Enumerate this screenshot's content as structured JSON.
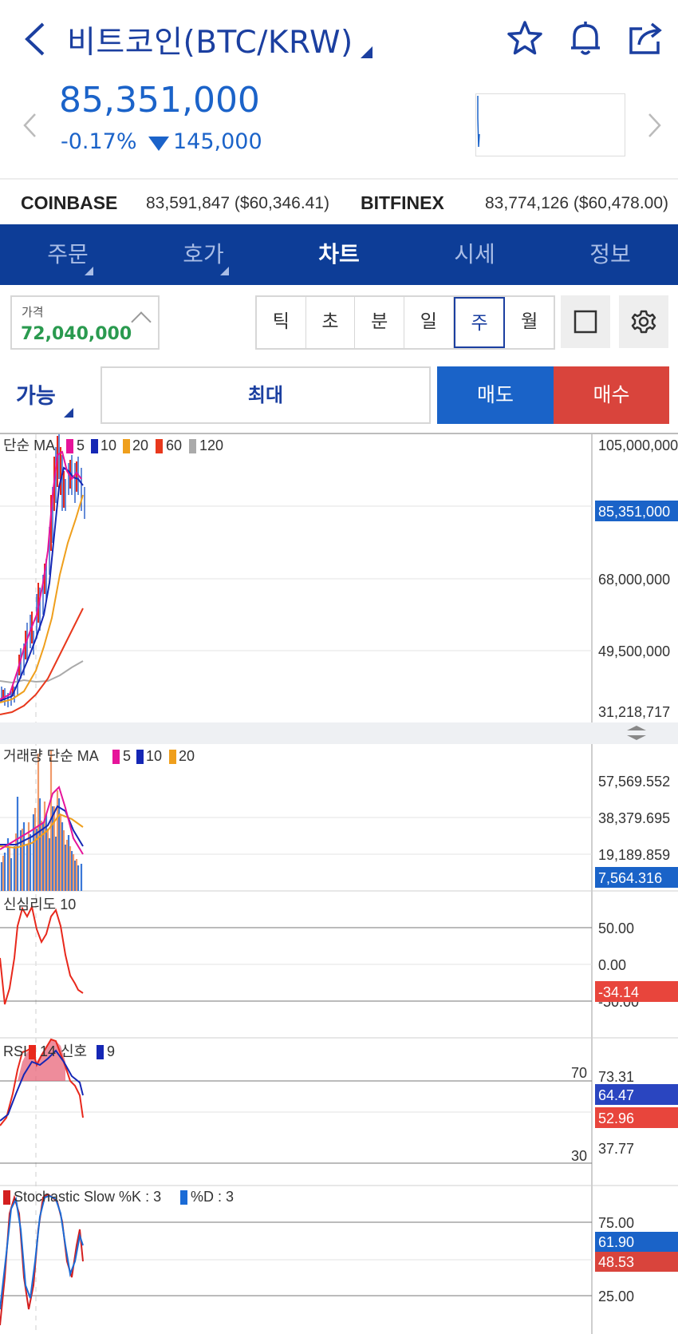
{
  "header": {
    "title": "비트코인(BTC/KRW)",
    "price": "85,351,000",
    "change_pct": "-0.17%",
    "change_amt": "145,000"
  },
  "exchanges": [
    {
      "name": "COINBASE",
      "value": "83,591,847 ($60,346.41)"
    },
    {
      "name": "BITFINEX",
      "value": "83,774,126 ($60,478.00)"
    }
  ],
  "tabs": [
    "주문",
    "호가",
    "차트",
    "시세",
    "정보"
  ],
  "active_tab": "차트",
  "toolbar": {
    "price_label": "가격",
    "price_value": "72,040,000",
    "periods": [
      "틱",
      "초",
      "분",
      "일",
      "주",
      "월"
    ],
    "active_period": "주"
  },
  "order": {
    "avail_label": "가능",
    "max_label": "최대",
    "sell_label": "매도",
    "buy_label": "매수"
  },
  "colors": {
    "accent_blue": "#0d3d97",
    "price_blue": "#1b63c9",
    "sell_blue": "#1a63c8",
    "buy_red": "#d9443c",
    "up_green": "#2a9a4f"
  },
  "chart_data": [
    {
      "type": "line",
      "legend_prefix": "단순 MA",
      "series": [
        {
          "name": "5",
          "color": "#e6149a"
        },
        {
          "name": "10",
          "color": "#1527b5"
        },
        {
          "name": "20",
          "color": "#ef9f1c"
        },
        {
          "name": "60",
          "color": "#e8381c"
        },
        {
          "name": "120",
          "color": "#aaaaaa"
        }
      ],
      "y_ticks": [
        "105,000,000",
        "68,000,000",
        "49,500,000",
        "31,218,717"
      ],
      "current_value": "85,351,000"
    },
    {
      "type": "bar",
      "legend_prefix": "거래량 단순 MA",
      "series": [
        {
          "name": "5",
          "color": "#e6149a"
        },
        {
          "name": "10",
          "color": "#1527b5"
        },
        {
          "name": "20",
          "color": "#ef9f1c"
        }
      ],
      "y_ticks": [
        "57,569.552",
        "38,379.695",
        "19,189.859"
      ],
      "current_value": "7,564.316"
    },
    {
      "type": "line",
      "legend": "신심리도 10",
      "y_ticks": [
        "50.00",
        "0.00",
        "-50.00"
      ],
      "current_value": "-34.14"
    },
    {
      "type": "line",
      "legend_prefix": "RSI",
      "series": [
        {
          "name": "14",
          "color": "#e8281c"
        },
        {
          "name": "신호",
          "color": "#1527b5"
        },
        {
          "name": "9",
          "color": "#1527b5"
        }
      ],
      "level_labels": [
        "70",
        "30"
      ],
      "y_ticks": [
        "73.31",
        "37.77"
      ],
      "badges": [
        "64.47",
        "52.96"
      ]
    },
    {
      "type": "line",
      "series": [
        {
          "name": "Stochastic Slow %K : 3",
          "color": "#d41f1f"
        },
        {
          "name": "%D : 3",
          "color": "#1a6bd6"
        }
      ],
      "y_ticks": [
        "75.00",
        "25.00"
      ],
      "badges": [
        "61.90",
        "48.53"
      ]
    }
  ]
}
